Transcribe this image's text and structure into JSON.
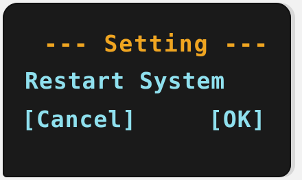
{
  "screen": {
    "title": "--- Setting ---",
    "message": "Restart System",
    "cancel_label": "[Cancel]",
    "ok_label": "[OK]"
  },
  "colors": {
    "title": "#f0a520",
    "text": "#8fe0ee",
    "background": "#1a1a1a"
  }
}
